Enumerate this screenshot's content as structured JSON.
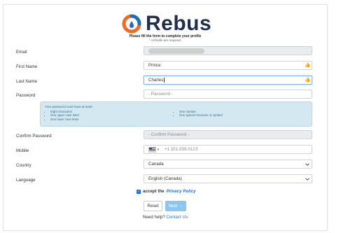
{
  "brand": {
    "name": "Rebus",
    "logo_colors": [
      "#f26b22",
      "#1f6fb5"
    ]
  },
  "header": {
    "subtitle": "Please fill the form to complete your profile",
    "required_note": "* All fields are required."
  },
  "form": {
    "email": {
      "label": "Email",
      "value": ""
    },
    "first_name": {
      "label": "First Name",
      "value": "Prince"
    },
    "last_name": {
      "label": "Last Name",
      "value": "Charles"
    },
    "password": {
      "label": "Password",
      "placeholder": "- Password -"
    },
    "password_rules": {
      "title": "Your password must have at least:",
      "left": [
        "Eight characters",
        "One upper case letter",
        "One lower case letter"
      ],
      "right": [
        "One number",
        "One special character or symbol"
      ]
    },
    "confirm_password": {
      "label": "Confirm Password",
      "placeholder": "- Confirm Password -"
    },
    "mobile": {
      "label": "Mobile",
      "placeholder": "+1 201-555-0123",
      "country_code_icon": "us-flag-icon"
    },
    "country": {
      "label": "Country",
      "value": "Canada"
    },
    "language": {
      "label": "Language",
      "value": "English (Canada)"
    },
    "privacy": {
      "checked": true,
      "prefix": "accept the",
      "link_text": "Privacy Policy"
    }
  },
  "buttons": {
    "reset": "Reset",
    "next": "Next →"
  },
  "help": {
    "text": "Need help?",
    "link": "Contact Us"
  },
  "colors": {
    "accent": "#0d6efd",
    "link": "#1a73e8",
    "valid": "#5cb85c",
    "info_bg": "#d4e8f2",
    "next_bg": "#8ec5ee"
  }
}
